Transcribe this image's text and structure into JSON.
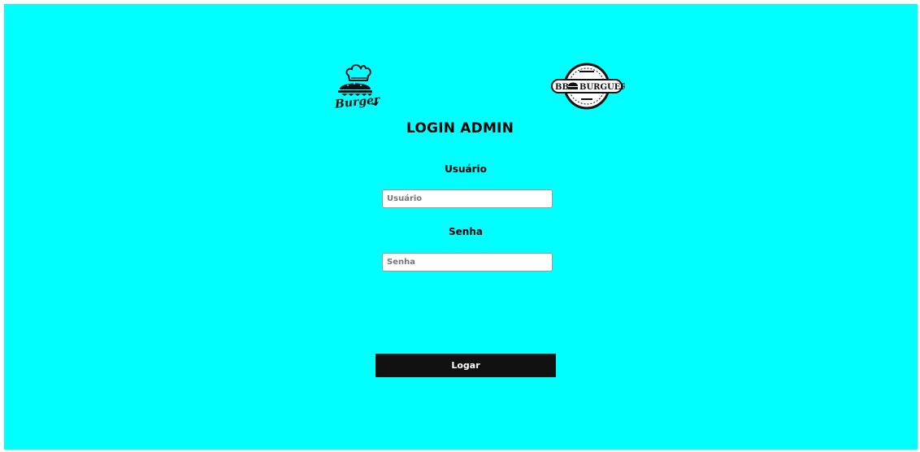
{
  "header": {
    "logos": [
      {
        "icon": "burger-chef-logo-icon",
        "brand_text": "Burger"
      },
      {
        "icon": "bb-burguer-badge-logo-icon",
        "brand_text": "BB BURGUER"
      }
    ],
    "title": "LOGIN ADMIN"
  },
  "form": {
    "username": {
      "label": "Usuário",
      "placeholder": "Usuário",
      "value": ""
    },
    "password": {
      "label": "Senha",
      "placeholder": "Senha",
      "value": ""
    },
    "submit_label": "Logar"
  },
  "colors": {
    "background": "#00ffff",
    "button": "#111111",
    "button_text": "#ffffff"
  }
}
